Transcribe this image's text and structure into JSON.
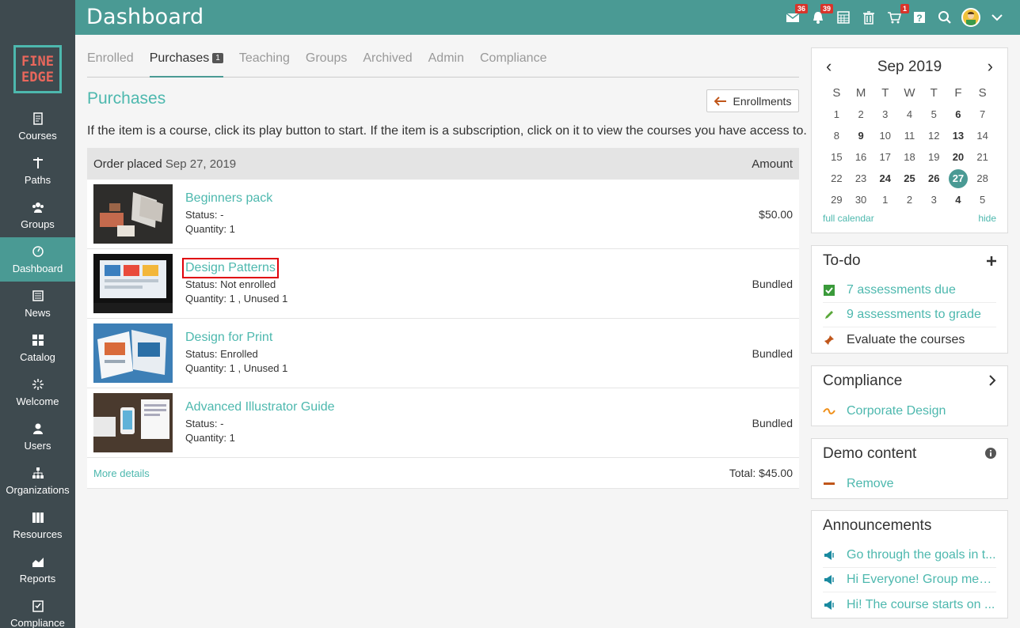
{
  "header": {
    "title": "Dashboard",
    "icons": [
      {
        "name": "inbox-icon",
        "badge": "36"
      },
      {
        "name": "bell-icon",
        "badge": "39"
      },
      {
        "name": "calendar-icon",
        "badge": ""
      },
      {
        "name": "trash-icon",
        "badge": ""
      },
      {
        "name": "cart-icon",
        "badge": "1"
      },
      {
        "name": "help-icon",
        "badge": ""
      },
      {
        "name": "search-icon",
        "badge": ""
      }
    ]
  },
  "logo": {
    "line1": "FINE",
    "line2": "EDGE"
  },
  "sidebar": {
    "items": [
      {
        "label": "Courses"
      },
      {
        "label": "Paths"
      },
      {
        "label": "Groups"
      },
      {
        "label": "Dashboard"
      },
      {
        "label": "News"
      },
      {
        "label": "Catalog"
      },
      {
        "label": "Welcome"
      },
      {
        "label": "Users"
      },
      {
        "label": "Organizations"
      },
      {
        "label": "Resources"
      },
      {
        "label": "Reports"
      },
      {
        "label": "Compliance"
      }
    ]
  },
  "tabs": {
    "enrolled": "Enrolled",
    "purchases": "Purchases",
    "purchases_badge": "1",
    "teaching": "Teaching",
    "groups": "Groups",
    "archived": "Archived",
    "admin": "Admin",
    "compliance": "Compliance"
  },
  "page": {
    "heading": "Purchases",
    "enroll_button": "Enrollments",
    "info": "If the item is a course, click its play button to start. If the item is a subscription, click on it to view the courses you have access to."
  },
  "order": {
    "placed_label": "Order placed",
    "placed_date": "Sep 27, 2019",
    "amount_header": "Amount",
    "items": [
      {
        "title": "Beginners pack",
        "status_label": "Status:",
        "status": "-",
        "qty_label": "Quantity:",
        "qty": "1",
        "amount": "$50.00"
      },
      {
        "title": "Design Patterns",
        "status_label": "Status:",
        "status": "Not enrolled",
        "qty_label": "Quantity:",
        "qty": "1 , Unused 1",
        "amount": "Bundled"
      },
      {
        "title": "Design for Print",
        "status_label": "Status:",
        "status": "Enrolled",
        "qty_label": "Quantity:",
        "qty": "1 , Unused 1",
        "amount": "Bundled"
      },
      {
        "title": "Advanced Illustrator Guide",
        "status_label": "Status:",
        "status": "-",
        "qty_label": "Quantity:",
        "qty": "1",
        "amount": "Bundled"
      }
    ],
    "more_details": "More details",
    "total_label": "Total:",
    "total": "$45.00"
  },
  "calendar": {
    "title": "Sep 2019",
    "prev": "‹",
    "next": "›",
    "dow": [
      "S",
      "M",
      "T",
      "W",
      "T",
      "F",
      "S"
    ],
    "days": [
      [
        "1",
        "",
        "0"
      ],
      [
        "2",
        "",
        "0"
      ],
      [
        "3",
        "",
        "0"
      ],
      [
        "4",
        "",
        "0"
      ],
      [
        "5",
        "",
        "0"
      ],
      [
        "6",
        "b",
        "0"
      ],
      [
        "7",
        "",
        "0"
      ],
      [
        "8",
        "",
        "0"
      ],
      [
        "9",
        "b",
        "0"
      ],
      [
        "10",
        "",
        "0"
      ],
      [
        "11",
        "",
        "0"
      ],
      [
        "12",
        "",
        "0"
      ],
      [
        "13",
        "b",
        "0"
      ],
      [
        "14",
        "",
        "0"
      ],
      [
        "15",
        "",
        "0"
      ],
      [
        "16",
        "",
        "0"
      ],
      [
        "17",
        "",
        "0"
      ],
      [
        "18",
        "",
        "0"
      ],
      [
        "19",
        "",
        "0"
      ],
      [
        "20",
        "b",
        "0"
      ],
      [
        "21",
        "",
        "0"
      ],
      [
        "22",
        "",
        "0"
      ],
      [
        "23",
        "",
        "0"
      ],
      [
        "24",
        "b",
        "0"
      ],
      [
        "25",
        "b",
        "0"
      ],
      [
        "26",
        "b",
        "0"
      ],
      [
        "27",
        "b",
        "1"
      ],
      [
        "28",
        "",
        "0"
      ],
      [
        "29",
        "",
        "0"
      ],
      [
        "30",
        "",
        "0"
      ],
      [
        "1",
        "",
        "0"
      ],
      [
        "2",
        "",
        "0"
      ],
      [
        "3",
        "",
        "0"
      ],
      [
        "4",
        "b",
        "0"
      ],
      [
        "5",
        "",
        "0"
      ]
    ],
    "full_calendar": "full calendar",
    "hide": "hide"
  },
  "todo": {
    "title": "To-do",
    "items": [
      "7 assessments due",
      "9 assessments to grade",
      "Evaluate the courses"
    ]
  },
  "compliance": {
    "title": "Compliance",
    "items": [
      "Corporate Design"
    ]
  },
  "demo": {
    "title": "Demo content",
    "items": [
      "Remove"
    ]
  },
  "announcements": {
    "title": "Announcements",
    "items": [
      "Go through the goals in t...",
      "Hi Everyone! Group meeti...",
      "Hi! The course starts on ..."
    ]
  },
  "colors": {
    "topbar": "#4a9a94",
    "sidebar": "#3e4a4f",
    "accent": "#4db8ae",
    "badge": "#d9342b"
  }
}
